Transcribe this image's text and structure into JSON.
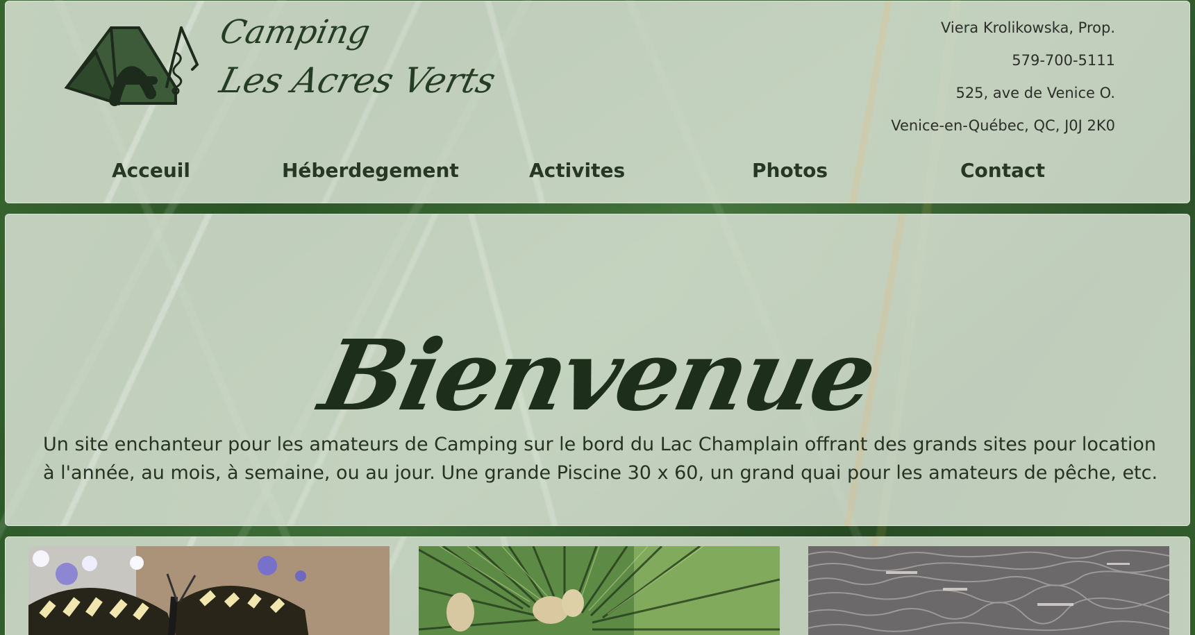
{
  "site": {
    "logo": {
      "line_1": "Camping",
      "line_2": "Les Acres Verts",
      "icon": "camping-tent-a-logo-icon"
    },
    "contact": {
      "proprietor": "Viera Krolikowska, Prop.",
      "phone": "579-700-5111",
      "street": "525, ave de Venice O.",
      "city": "Venice-en-Québec, QC, J0J 2K0"
    },
    "navigation": [
      {
        "label": "Acceuil"
      },
      {
        "label": "Héberdegement"
      },
      {
        "label": "Activites"
      },
      {
        "label": "Photos"
      },
      {
        "label": "Contact"
      }
    ],
    "hero": {
      "title": "Bienvenue",
      "description": "Un site enchanteur pour les amateurs de Camping sur le bord du Lac Champlain offrant des grands sites pour location à l'année, au mois, à semaine, ou au jour. Une grande Piscine 30 x 60, un grand quai pour les amateurs de pêche, etc."
    },
    "gallery": [
      {
        "icon": "butterfly-flower-photo"
      },
      {
        "icon": "pine-branch-photo"
      },
      {
        "icon": "lake-water-photo"
      }
    ],
    "colors": {
      "text_dark": "#263723",
      "panel": "rgba(220, 229, 216, 0.84)",
      "logo_green": "#3b5a36"
    }
  }
}
